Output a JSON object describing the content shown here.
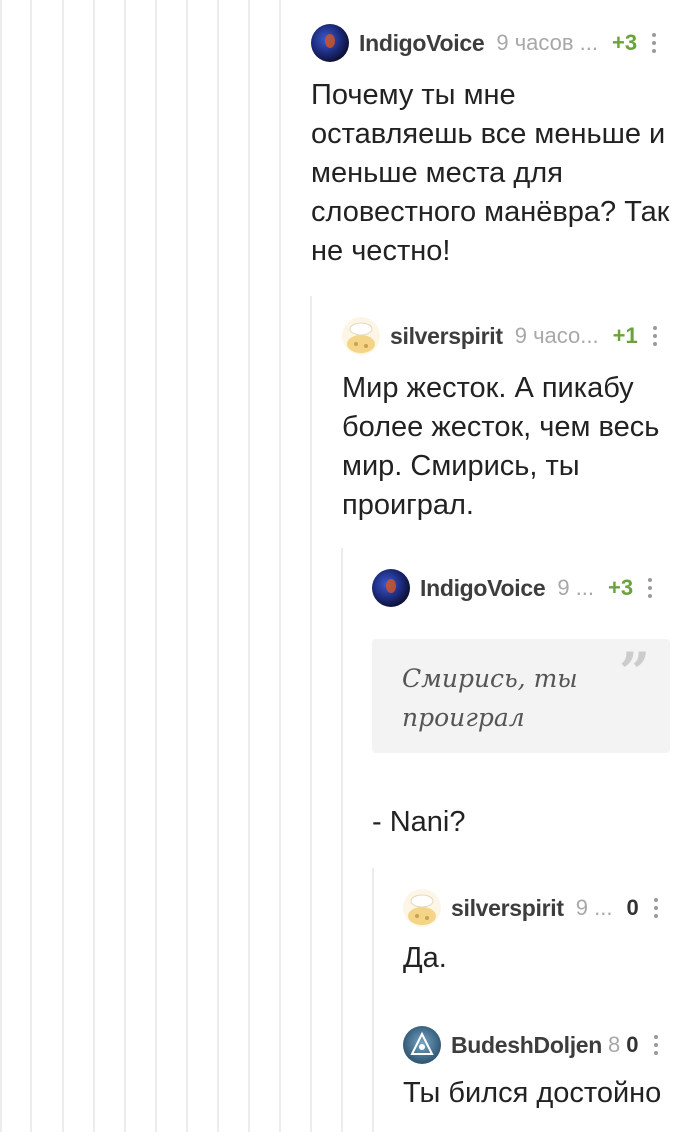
{
  "comments": [
    {
      "username": "IndigoVoice",
      "time": "9 часов ...",
      "rating": "+3",
      "text": "Почему ты мне оставляешь все меньше и меньше места для словестного манёвра? Так не честно!"
    },
    {
      "username": "silverspirit",
      "time": "9 часо...",
      "rating": "+1",
      "text": "Мир жесток. А пикабу более жесток, чем весь мир. Смирись, ты проиграл."
    },
    {
      "username": "IndigoVoice",
      "time": "9 ...",
      "rating": "+3",
      "quote": "Смирись, ты проиграл",
      "text": "- Nani?"
    },
    {
      "username": "silverspirit",
      "time": "9 ...",
      "rating": "0",
      "text": "Да."
    },
    {
      "username": "BudeshDoljen",
      "time": "8",
      "rating": "0",
      "text": "Ты бился достойно"
    }
  ],
  "icons": {
    "more": "more-vertical-icon",
    "quote": "quote-icon"
  },
  "colors": {
    "rating_positive": "#6aa23b",
    "thread_line": "#ececec",
    "quote_bg": "#f3f3f3"
  }
}
